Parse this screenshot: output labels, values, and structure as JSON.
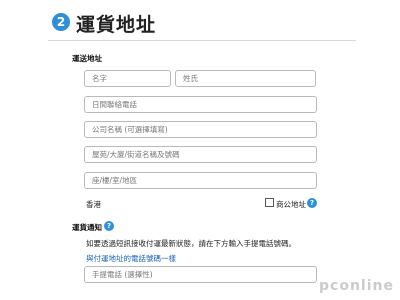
{
  "header": {
    "step_number": "2",
    "title": "運貨地址"
  },
  "shipping_address": {
    "section_label": "運送地址",
    "first_name_placeholder": "名字",
    "last_name_placeholder": "姓氏",
    "daytime_phone_placeholder": "日間聯絡電話",
    "company_placeholder": "公司名稱 (可選擇填寫)",
    "address_line1_placeholder": "屋苑/大廈/街道名稱及號碼",
    "address_line2_placeholder": "座/樓/室/地區",
    "region_label": "香港",
    "business_address_label": "商公地址"
  },
  "shipping_notification": {
    "section_label": "運貨通知",
    "description": "如要透過短訊接收付運最新狀態，請在下方輸入手提電話號碼。",
    "same_as_billing_link": "與付運地址的電話號碼一樣",
    "mobile_placeholder": "手提電話 (選擇性)"
  },
  "watermark": "pconline"
}
